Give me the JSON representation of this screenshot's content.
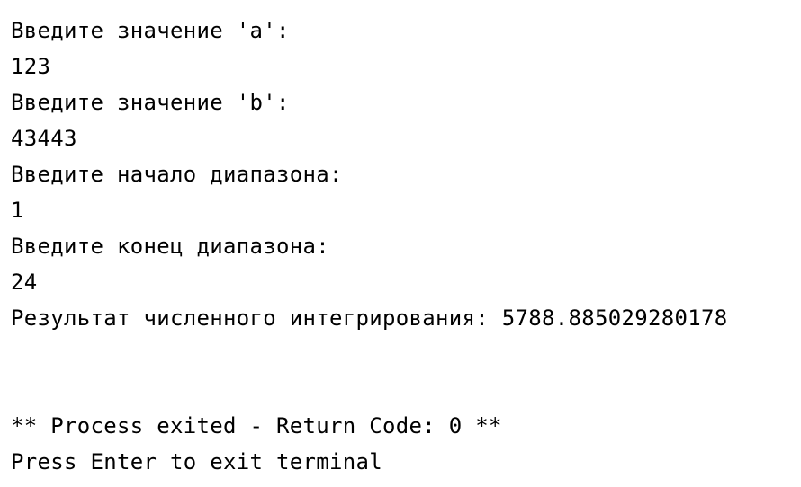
{
  "terminal": {
    "lines": [
      "Введите значение 'a':",
      "123",
      "Введите значение 'b':",
      "43443",
      "Введите начало диапазона:",
      "1",
      "Введите конец диапазона:",
      "24",
      "Результат численного интегрирования: 5788.885029280178",
      "",
      "",
      "** Process exited - Return Code: 0 **",
      "Press Enter to exit terminal"
    ]
  },
  "colors": {
    "background": "#ffffff",
    "text": "#000000"
  }
}
